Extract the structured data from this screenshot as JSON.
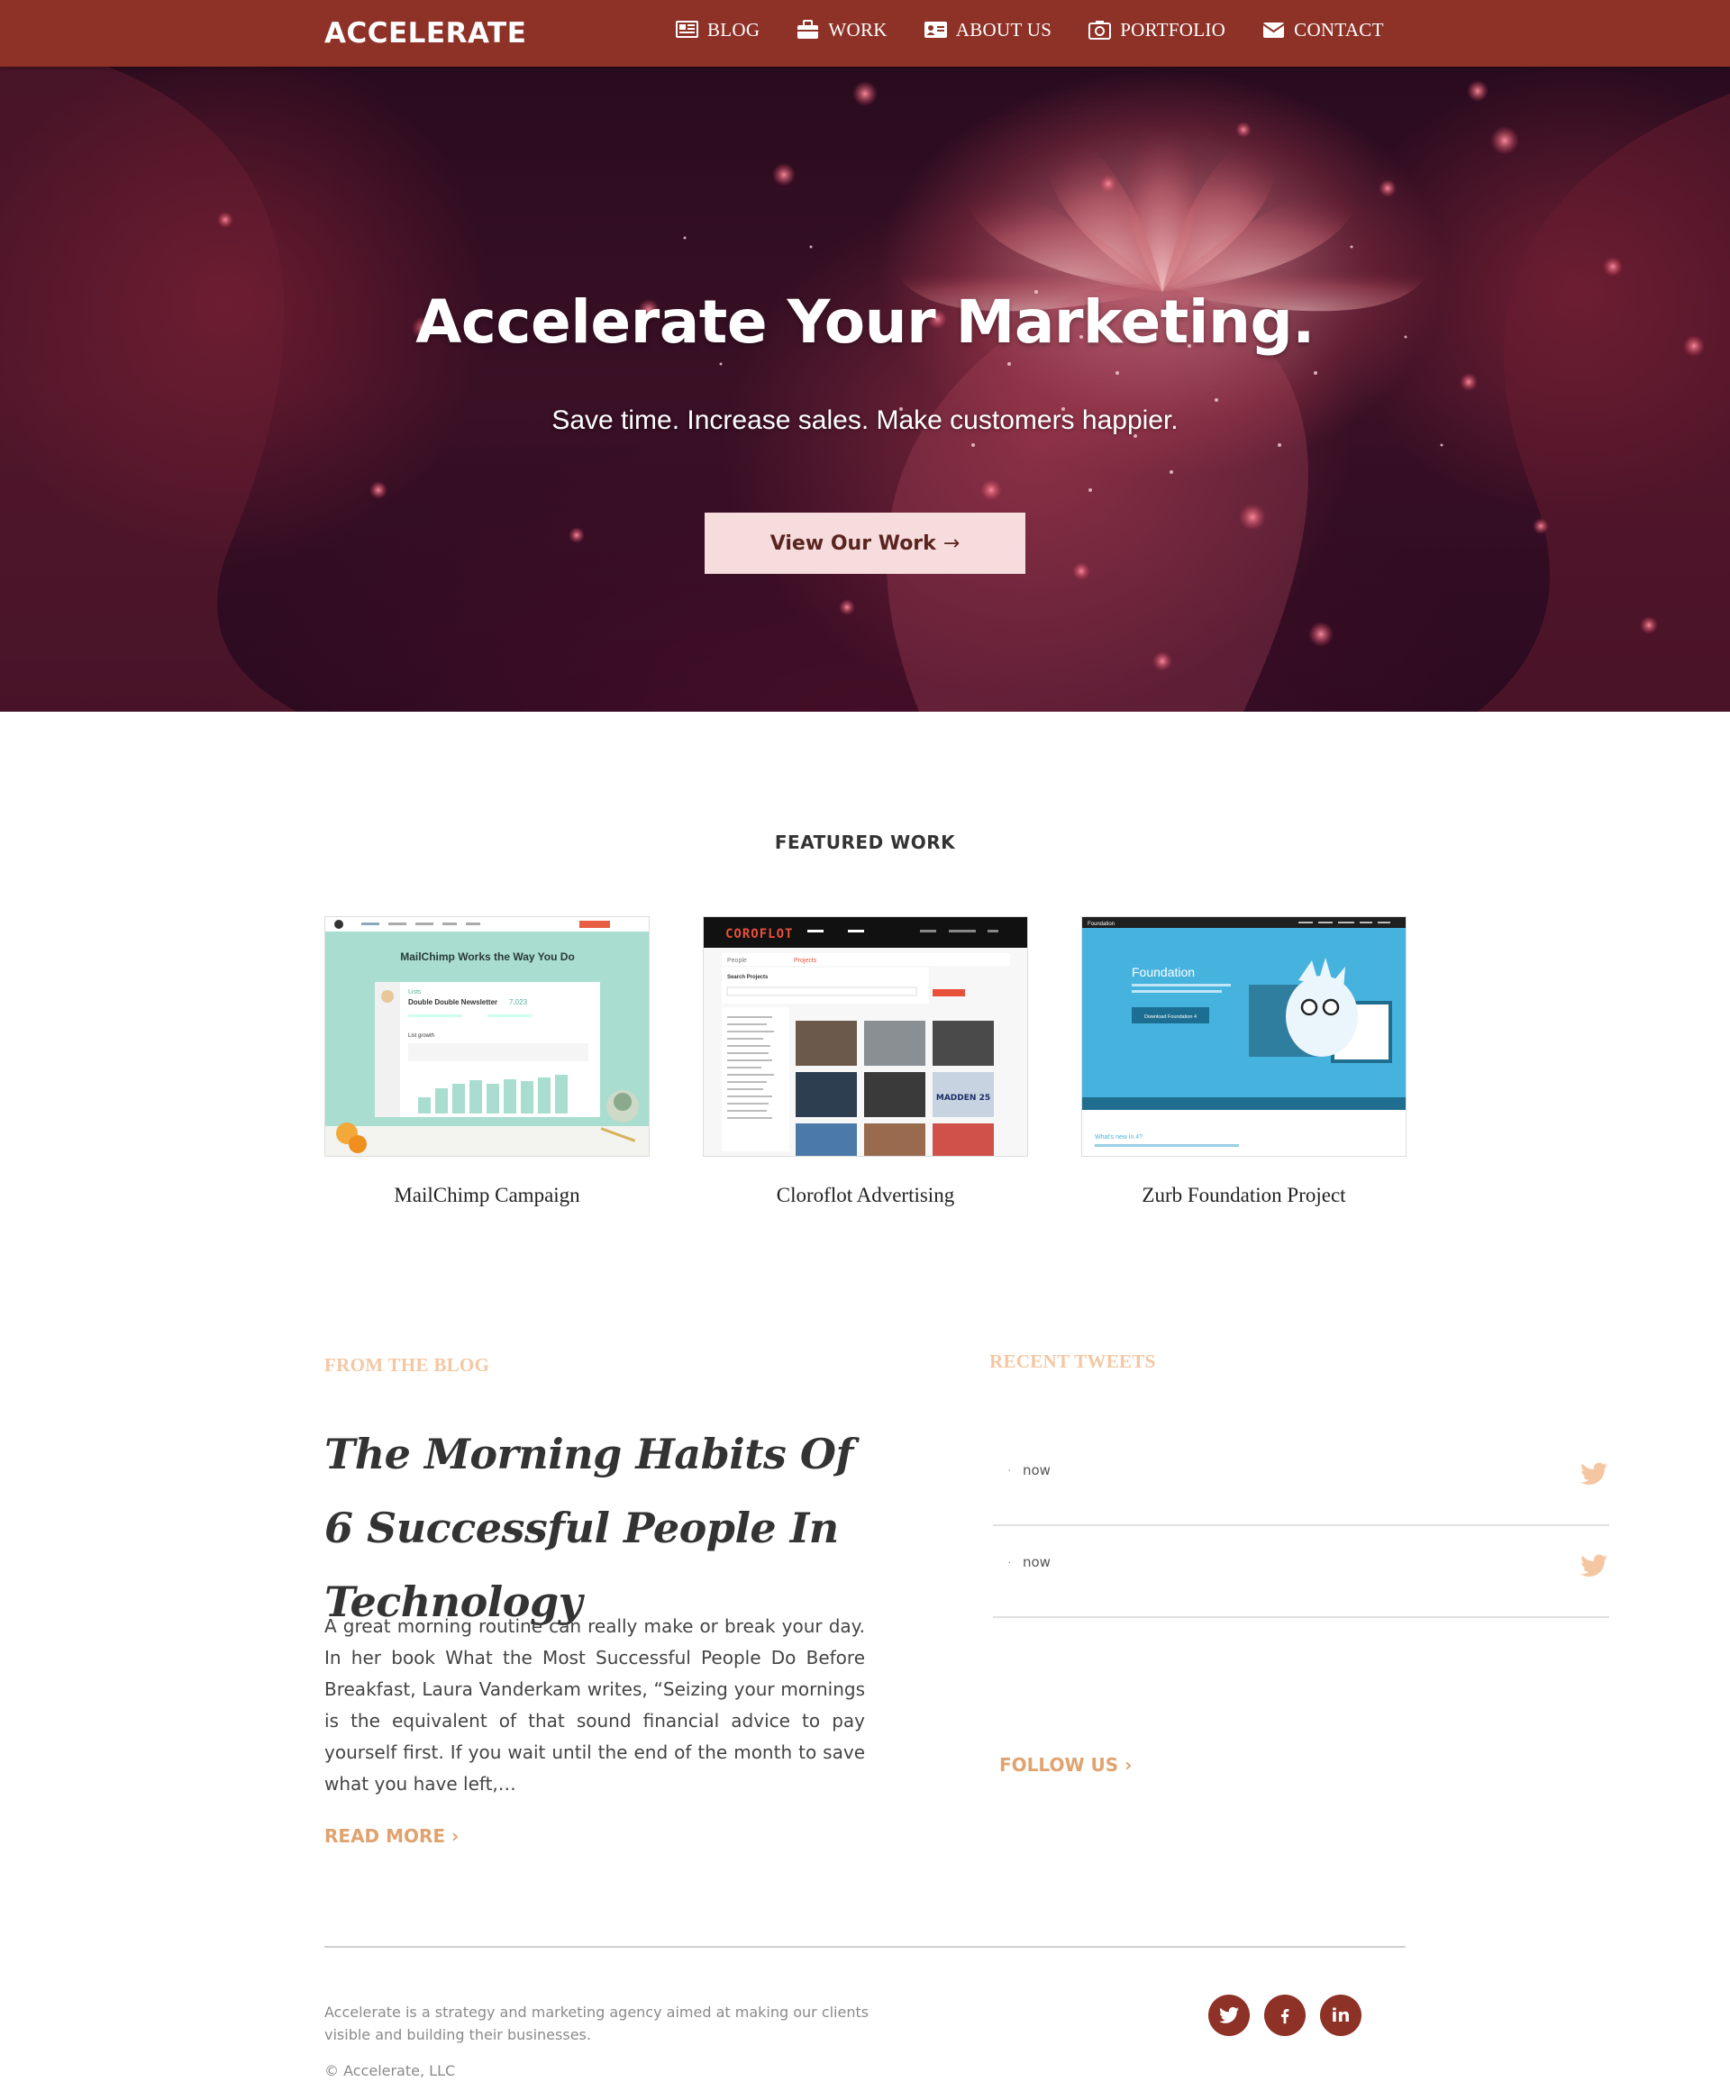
{
  "header": {
    "logo": "ACCELERATE",
    "nav": [
      {
        "label": "BLOG",
        "icon": "newspaper-icon"
      },
      {
        "label": "WORK",
        "icon": "briefcase-icon"
      },
      {
        "label": "ABOUT US",
        "icon": "id-card-icon"
      },
      {
        "label": "PORTFOLIO",
        "icon": "camera-icon"
      },
      {
        "label": "CONTACT",
        "icon": "envelope-icon"
      }
    ]
  },
  "hero": {
    "title": "Accelerate Your Marketing.",
    "subtitle": "Save time. Increase sales. Make customers happier.",
    "button_label": "View Our Work",
    "button_arrow": "→"
  },
  "featured": {
    "heading": "FEATURED WORK",
    "items": [
      {
        "caption": "MailChimp Campaign",
        "thumb": {
          "headline": "MailChimp Works the Way You Do",
          "panel_title": "Double Double Newsletter",
          "panel_value": "7,023",
          "panel_tag": "Lists",
          "chart_label": "List growth"
        }
      },
      {
        "caption": "Cloroflot Advertising",
        "thumb": {
          "brand": "COROFLOT",
          "tab_people": "People",
          "tab_projects": "Projects",
          "search_label": "Search Projects",
          "badge": "MADDEN 25"
        }
      },
      {
        "caption": "Zurb Foundation Project",
        "thumb": {
          "brand": "Foundation",
          "title": "Foundation",
          "button": "Download Foundation 4",
          "footer": "What's new in 4?"
        }
      }
    ]
  },
  "blog": {
    "label": "FROM THE BLOG",
    "title": "The Morning Habits Of 6 Successful People In Technology",
    "excerpt": "A great morning routine can really make or break your day. In her book What the Most Successful People Do Before Breakfast, Laura Vanderkam writes, “Seizing your mornings is the equivalent of that sound financial advice to pay yourself first. If you wait until the end of the month to save what you have left,…",
    "read_more": "READ MORE ›"
  },
  "tweets": {
    "label": "RECENT TWEETS",
    "items": [
      {
        "bullet": "·",
        "time": "now"
      },
      {
        "bullet": "·",
        "time": "now"
      }
    ],
    "follow_us": "FOLLOW US ›"
  },
  "footer": {
    "about": "Accelerate is a strategy and marketing agency aimed at making our clients visible and building their businesses.",
    "copyright": "© Accelerate, LLC",
    "social": [
      {
        "icon": "twitter-icon"
      },
      {
        "icon": "facebook-icon"
      },
      {
        "icon": "linkedin-icon",
        "text": "in"
      }
    ]
  },
  "colors": {
    "brand": "#8e3127",
    "hero_button_bg": "#f6dcdc",
    "accent_peach": "#e0a36f",
    "label_peach": "#f4c7a2",
    "tweet_bird": "#f4c7a2"
  }
}
